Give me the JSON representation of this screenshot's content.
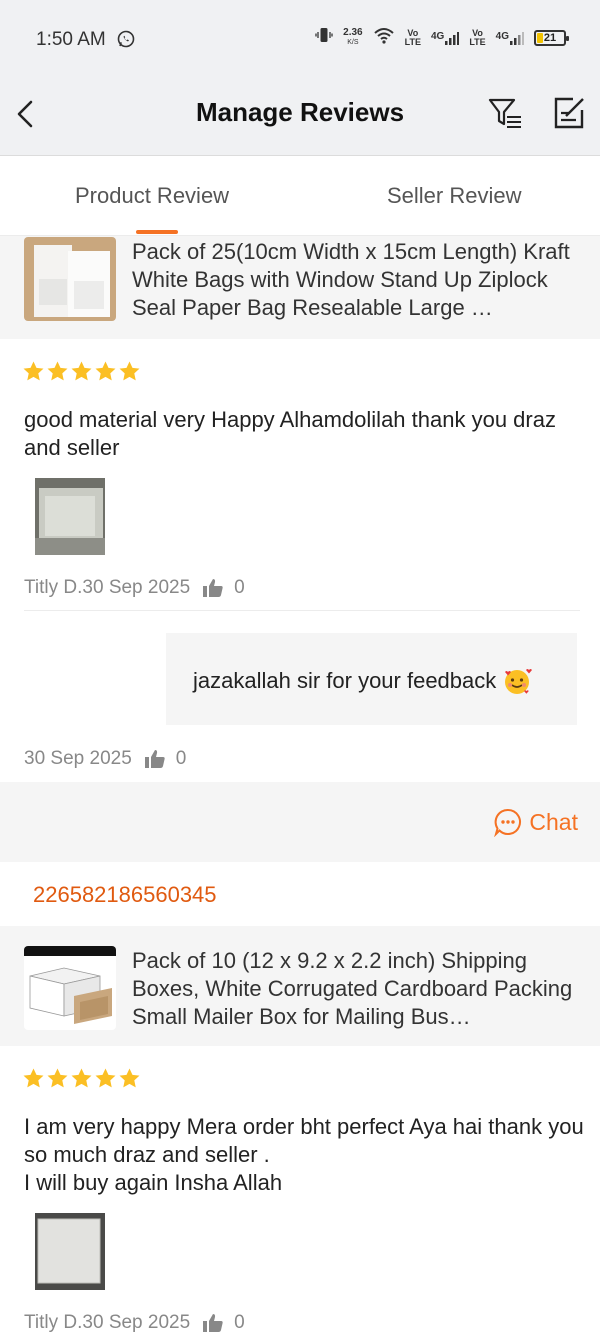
{
  "status_bar": {
    "time": "1:50 AM",
    "net_speed_value": "2.36",
    "net_speed_unit": "K/S",
    "sim1_tag": "Vo\nLTE",
    "sim1_net": "4G",
    "sim2_tag": "Vo\nLTE",
    "sim2_net": "4G",
    "battery": "21",
    "battery_level": 0.21
  },
  "header": {
    "title": "Manage Reviews"
  },
  "tabs": {
    "product": "Product Review",
    "seller": "Seller Review",
    "active": "product"
  },
  "reviews": [
    {
      "product_title": "Pack of 25(10cm Width x 15cm Length) Kraft White Bags with Window Stand Up Ziplock Seal Paper Bag Resealable Large …",
      "rating": 5,
      "text": "good material very Happy Alhamdolilah thank you draz and seller",
      "reviewer": "Titly D.",
      "date": "30 Sep 2025",
      "likes": "0",
      "reply": {
        "text": "jazakallah sir for your feedback",
        "date": "30 Sep 2025",
        "likes": "0"
      }
    },
    {
      "order_id": "226582186560345",
      "product_title": "Pack of 10 (12 x 9.2 x 2.2 inch) Shipping Boxes, White Corrugated Cardboard Packing Small Mailer Box for Mailing Bus…",
      "rating": 5,
      "text": "I am very happy Mera order bht perfect Aya hai thank you so much draz and seller .\nI will buy again Insha Allah",
      "reviewer": "Titly D.",
      "date": "30 Sep 2025",
      "likes": "0"
    }
  ],
  "chat": {
    "label": "Chat"
  },
  "colors": {
    "accent": "#f57224",
    "star": "#fbbf24",
    "muted": "#888888"
  }
}
